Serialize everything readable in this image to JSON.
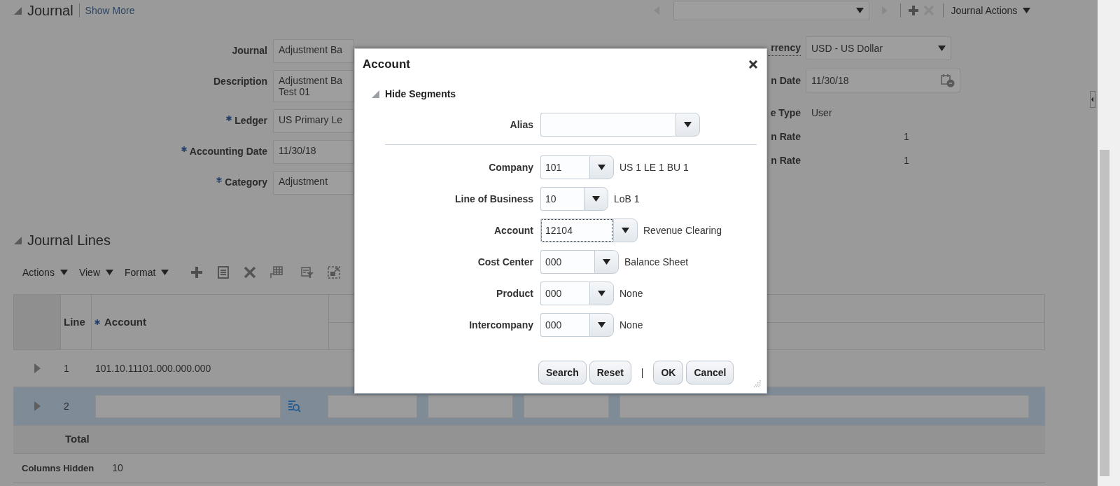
{
  "header": {
    "title": "Journal",
    "expanded": true,
    "link": "Show More",
    "menu": "Journal Actions"
  },
  "journal_fields": [
    {
      "label": "Journal",
      "required": false,
      "lines": [
        "Adjustment Ba"
      ]
    },
    {
      "label": "Description",
      "required": false,
      "lines": [
        "Adjustment Ba",
        "Test 01"
      ]
    },
    {
      "label": "Ledger",
      "required": true,
      "lines": [
        "US Primary Le"
      ]
    },
    {
      "label": "Accounting Date",
      "required": true,
      "lines": [
        "11/30/18"
      ]
    },
    {
      "label": "Category",
      "required": true,
      "lines": [
        "Adjustment"
      ]
    }
  ],
  "currency_fields": [
    {
      "label": "rrency",
      "kind": "select",
      "value": "USD - US Dollar"
    },
    {
      "label": "n Date",
      "kind": "date",
      "value": "11/30/18"
    },
    {
      "label": "e Type",
      "kind": "text",
      "value": "User"
    },
    {
      "label": "n Rate",
      "kind": "number",
      "value": "1"
    },
    {
      "label": "n Rate",
      "kind": "number",
      "value": "1"
    }
  ],
  "lines_section": {
    "title": "Journal Lines",
    "expanded": true,
    "menus": [
      "Actions",
      "View",
      "Format"
    ],
    "table": {
      "columns": [
        {
          "label": "Line",
          "required": false
        },
        {
          "label": "Account",
          "required": true
        }
      ],
      "rows": [
        {
          "line": "1",
          "kind": "display",
          "account": "101.10.11101.000.000.000",
          "selected": false
        },
        {
          "line": "2",
          "kind": "input",
          "selected": true
        }
      ],
      "footer": "Total"
    },
    "columns_hidden": {
      "label": "Columns Hidden",
      "value": "10"
    }
  },
  "dialog": {
    "title": "Account",
    "toggle": {
      "label": "Hide Segments",
      "expanded": true
    },
    "alias": {
      "label": "Alias"
    },
    "segments": [
      {
        "label": "Company",
        "value": "101",
        "description": "US 1 LE 1 BU 1",
        "focused": false
      },
      {
        "label": "Line of Business",
        "value": "10",
        "description": "LoB 1",
        "focused": false
      },
      {
        "label": "Account",
        "value": "12104",
        "description": "Revenue Clearing",
        "focused": true
      },
      {
        "label": "Cost Center",
        "value": "000",
        "description": "Balance Sheet",
        "focused": false
      },
      {
        "label": "Product",
        "value": "000",
        "description": "None",
        "focused": false
      },
      {
        "label": "Intercompany",
        "value": "000",
        "description": "None",
        "focused": false
      }
    ],
    "buttons": [
      {
        "kind": "action",
        "label": "Search"
      },
      {
        "kind": "action",
        "label": "Reset"
      },
      {
        "kind": "separator",
        "label": "|"
      },
      {
        "kind": "action",
        "label": "OK"
      },
      {
        "kind": "action",
        "label": "Cancel"
      }
    ]
  }
}
